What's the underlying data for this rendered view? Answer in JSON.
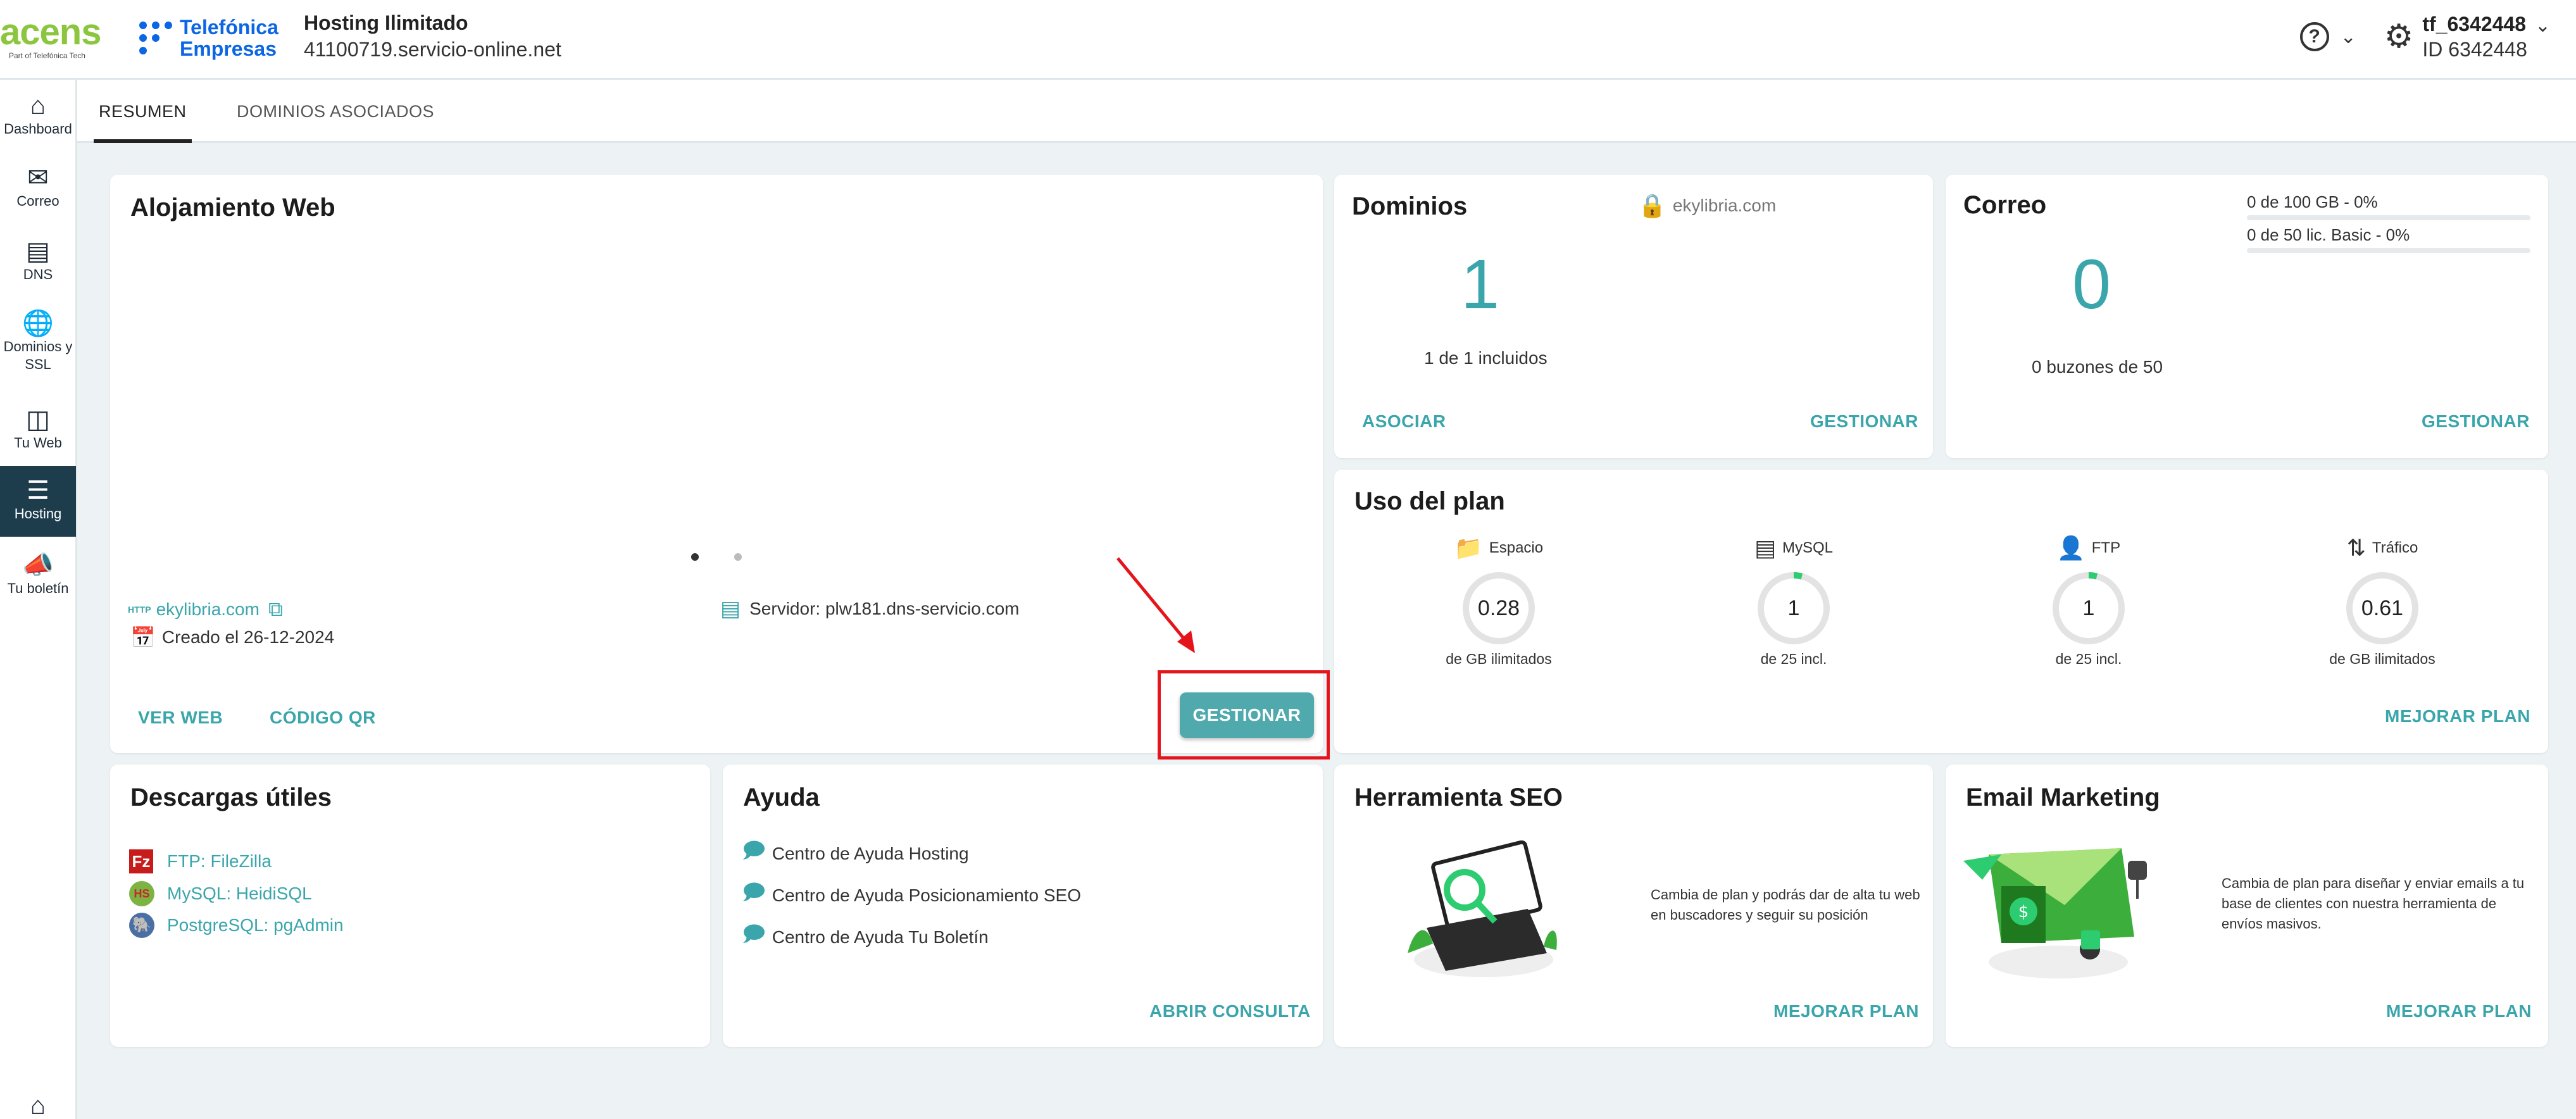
{
  "header": {
    "brand": "acens",
    "brand_tagline": "Part of Telefónica Tech",
    "partner_line1": "Telefónica",
    "partner_line2": "Empresas",
    "title": "Hosting Ilimitado",
    "subtitle": "41100719.servicio-online.net",
    "user_name": "tf_6342448",
    "user_id": "ID 6342448"
  },
  "sidebar": {
    "items": [
      {
        "label": "Dashboard",
        "icon": "home-icon"
      },
      {
        "label": "Correo",
        "icon": "mail-icon"
      },
      {
        "label": "DNS",
        "icon": "dns-icon"
      },
      {
        "label": "Dominios y SSL",
        "icon": "globe-icon"
      },
      {
        "label": "Tu Web",
        "icon": "web-icon"
      },
      {
        "label": "Hosting",
        "icon": "hosting-icon"
      },
      {
        "label": "Tu boletín",
        "icon": "megaphone-icon"
      }
    ]
  },
  "tabs": [
    "RESUMEN",
    "DOMINIOS ASOCIADOS"
  ],
  "alojamiento": {
    "title": "Alojamiento Web",
    "http_badge": "HTTP",
    "domain": "ekylibria.com",
    "created": "Creado el 26-12-2024",
    "server": "Servidor: plw181.dns-servicio.com",
    "ver_web": "VER WEB",
    "codigo_qr": "CÓDIGO QR",
    "gestionar": "GESTIONAR"
  },
  "dominios": {
    "title": "Dominios",
    "domain": "ekylibria.com",
    "count": "1",
    "included": "1 de 1 incluidos",
    "asociar": "ASOCIAR",
    "gestionar": "GESTIONAR"
  },
  "correo": {
    "title": "Correo",
    "storage": "0 de 100 GB - 0%",
    "licenses": "0 de 50 lic. Basic - 0%",
    "count": "0",
    "mailboxes": "0 buzones de 50",
    "gestionar": "GESTIONAR"
  },
  "uso_plan": {
    "title": "Uso del plan",
    "gauges": [
      {
        "label": "Espacio",
        "value": "0.28",
        "foot": "de GB ilimitados",
        "fraction": 0.0
      },
      {
        "label": "MySQL",
        "value": "1",
        "foot": "de 25 incl.",
        "fraction": 0.04
      },
      {
        "label": "FTP",
        "value": "1",
        "foot": "de 25 incl.",
        "fraction": 0.04
      },
      {
        "label": "Tráfico",
        "value": "0.61",
        "foot": "de GB ilimitados",
        "fraction": 0.0
      }
    ],
    "mejorar": "MEJORAR PLAN"
  },
  "descargas": {
    "title": "Descargas útiles",
    "items": [
      "FTP: FileZilla",
      "MySQL: HeidiSQL",
      "PostgreSQL: pgAdmin"
    ]
  },
  "ayuda": {
    "title": "Ayuda",
    "items": [
      "Centro de Ayuda Hosting",
      "Centro de Ayuda Posicionamiento SEO",
      "Centro de Ayuda Tu Boletín"
    ],
    "abrir": "ABRIR CONSULTA"
  },
  "seo": {
    "title": "Herramienta SEO",
    "text_line1": "Cambia de plan y podrás dar de alta tu web",
    "text_line2": "en buscadores y seguir su posición",
    "mejorar": "MEJORAR PLAN"
  },
  "email_marketing": {
    "title": "Email Marketing",
    "text_line1": "Cambia de plan para diseñar y enviar emails a tu",
    "text_line2": "base de clientes con nuestra herramienta de",
    "text_line3": "envíos masivos.",
    "mejorar": "MEJORAR PLAN"
  },
  "colors": {
    "accent": "#3aa6ab",
    "button": "#4fa9ad",
    "active_nav": "#1d3d4d",
    "annotation": "#e5141b",
    "gauge_fill": "#2ecc71"
  }
}
